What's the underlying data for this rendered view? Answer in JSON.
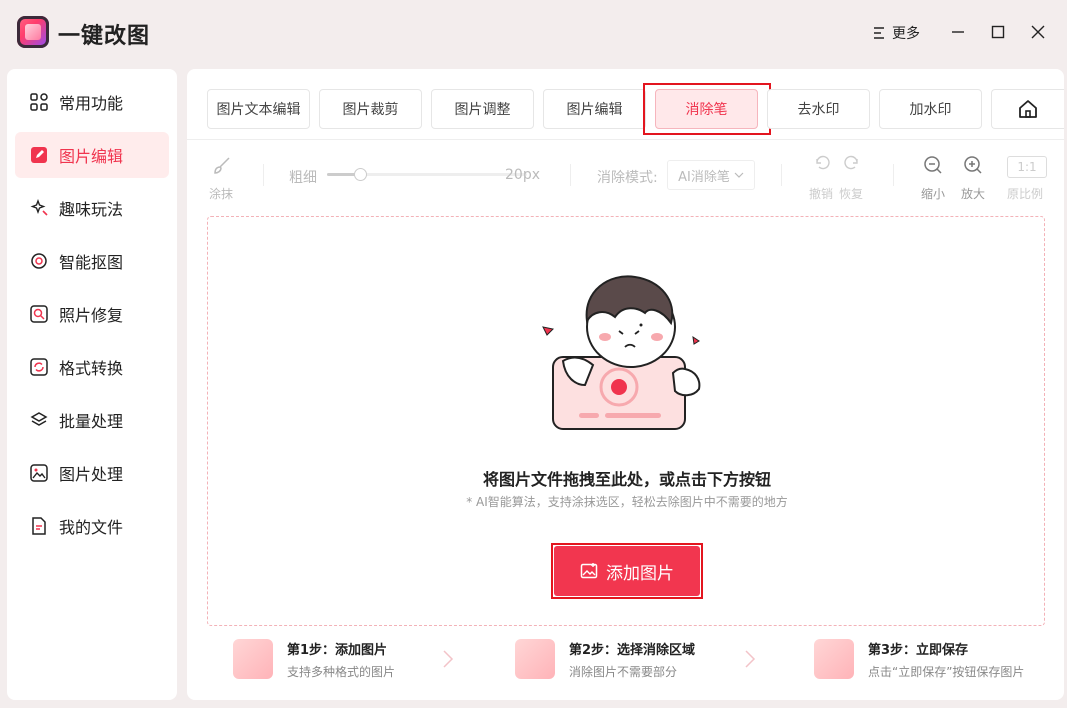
{
  "app": {
    "title": "一键改图",
    "more_label": "更多"
  },
  "sidebar": {
    "items": [
      {
        "label": "常用功能",
        "icon": "grid-icon"
      },
      {
        "label": "图片编辑",
        "icon": "edit-icon",
        "active": true
      },
      {
        "label": "趣味玩法",
        "icon": "sparkle-icon"
      },
      {
        "label": "智能抠图",
        "icon": "target-icon"
      },
      {
        "label": "照片修复",
        "icon": "repair-icon"
      },
      {
        "label": "格式转换",
        "icon": "convert-icon"
      },
      {
        "label": "批量处理",
        "icon": "layers-icon"
      },
      {
        "label": "图片处理",
        "icon": "image-icon"
      },
      {
        "label": "我的文件",
        "icon": "file-icon"
      }
    ]
  },
  "tabs": [
    {
      "label": "图片文本编辑"
    },
    {
      "label": "图片裁剪"
    },
    {
      "label": "图片调整"
    },
    {
      "label": "图片编辑"
    },
    {
      "label": "消除笔",
      "active": true
    },
    {
      "label": "去水印"
    },
    {
      "label": "加水印"
    }
  ],
  "toolbar": {
    "smear_label": "涂抹",
    "thickness_label": "粗细",
    "thickness_value": "20px",
    "thickness_fraction": 0.15,
    "mode_label": "消除模式:",
    "mode_value": "AI消除笔",
    "undo_label": "撤销",
    "redo_label": "恢复",
    "zoom_out_label": "缩小",
    "zoom_in_label": "放大",
    "ratio_value": "1:1",
    "original_label": "原比例"
  },
  "dropzone": {
    "title": "将图片文件拖拽至此处，或点击下方按钮",
    "subtitle": "* AI智能算法，支持涂抹选区，轻松去除图片中不需要的地方",
    "add_button": "添加图片"
  },
  "steps": [
    {
      "title": "第1步：添加图片",
      "desc": "支持多种格式的图片"
    },
    {
      "title": "第2步：选择消除区域",
      "desc": "消除图片不需要部分"
    },
    {
      "title": "第3步：立即保存",
      "desc": "点击“立即保存”按钮保存图片"
    }
  ],
  "colors": {
    "accent": "#f2364f",
    "highlight": "#e3151f"
  }
}
